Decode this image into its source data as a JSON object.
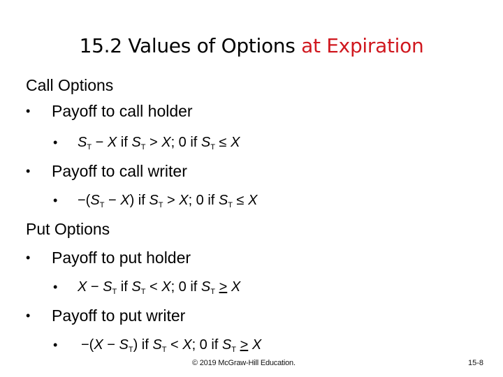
{
  "slide": {
    "title_main": "15.2 Values of Options ",
    "title_accent": "at Expiration",
    "accent_color": "#d0181f",
    "call_section": {
      "heading": "Call Options",
      "items": [
        {
          "label": "Payoff to call holder",
          "formula": {
            "a": "S",
            "b": "T",
            "c": " − ",
            "d": "X",
            "e": " if ",
            "f": "S",
            "g": "T",
            "h": " > ",
            "i": "X",
            "j": "; 0 if ",
            "k": "S",
            "l": "T",
            "m": " ≤ ",
            "n": "X"
          }
        },
        {
          "label": "Payoff to call writer",
          "formula": {
            "pre": "−(",
            "a": "S",
            "b": "T",
            "c": " − ",
            "d": "X",
            "post": ") if ",
            "f": "S",
            "g": "T",
            "h": " > ",
            "i": "X",
            "j": "; 0 if ",
            "k": "S",
            "l": "T",
            "m": " ≤ ",
            "n": "X"
          }
        }
      ]
    },
    "put_section": {
      "heading": "Put Options",
      "items": [
        {
          "label": "Payoff to put holder",
          "formula": {
            "a": "X",
            "c": " − ",
            "d": "S",
            "e": "T",
            "f": " if ",
            "g": "S",
            "h": "T",
            "i": " < ",
            "j": "X",
            "k": "; 0 if ",
            "l": "S",
            "m": "T",
            "n": " ",
            "o": ">",
            "p": " ",
            "q": "X"
          }
        },
        {
          "label": "Payoff to put writer",
          "formula": {
            "pre": "−(",
            "a": "X",
            "c": " − ",
            "d": "S",
            "e": "T",
            "f": ") if ",
            "g": "S",
            "h": "T",
            "i": " < ",
            "j": "X",
            "k": "; 0 if ",
            "l": "S",
            "m": "T",
            "n": " ",
            "o": ">",
            "p": " ",
            "q": "X"
          }
        }
      ]
    },
    "bullet_glyph": "•",
    "footer": "© 2019 McGraw-Hill Education.",
    "page_number": "15-8"
  }
}
